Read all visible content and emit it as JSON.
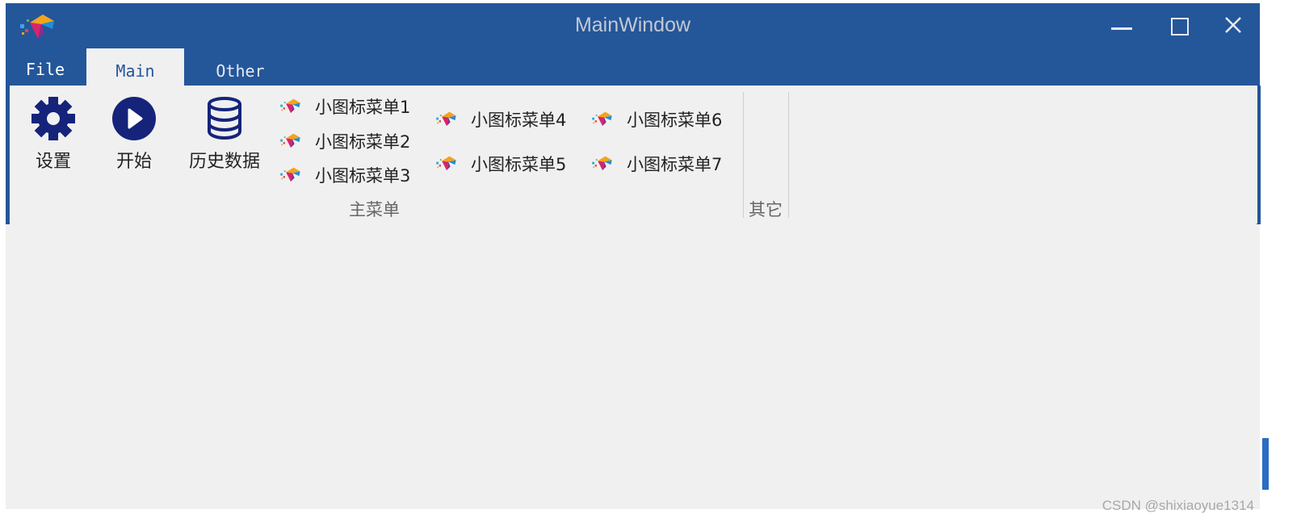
{
  "window": {
    "title": "MainWindow",
    "app_icon": "kite-logo-icon",
    "controls": [
      "minimize-icon",
      "maximize-icon",
      "close-icon"
    ]
  },
  "tabs": [
    {
      "label": "File",
      "active": false
    },
    {
      "label": "Main",
      "active": true
    },
    {
      "label": "Other",
      "active": false
    }
  ],
  "ribbon": {
    "main_group": {
      "label": "主菜单",
      "large_buttons": [
        {
          "label": "设置",
          "icon": "gear-icon"
        },
        {
          "label": "开始",
          "icon": "play-icon"
        },
        {
          "label": "历史数据",
          "icon": "database-icon"
        }
      ],
      "small_buttons": [
        {
          "label": "小图标菜单1",
          "icon": "kite-logo-icon"
        },
        {
          "label": "小图标菜单2",
          "icon": "kite-logo-icon"
        },
        {
          "label": "小图标菜单3",
          "icon": "kite-logo-icon"
        },
        {
          "label": "小图标菜单4",
          "icon": "kite-logo-icon"
        },
        {
          "label": "小图标菜单5",
          "icon": "kite-logo-icon"
        },
        {
          "label": "小图标菜单6",
          "icon": "kite-logo-icon"
        },
        {
          "label": "小图标菜单7",
          "icon": "kite-logo-icon"
        }
      ]
    },
    "other_group": {
      "label": "其它"
    }
  },
  "watermark": "CSDN @shixiaoyue1314",
  "colors": {
    "accent": "#24569a",
    "icon_navy": "#15247a",
    "background": "#f0f0f0"
  }
}
